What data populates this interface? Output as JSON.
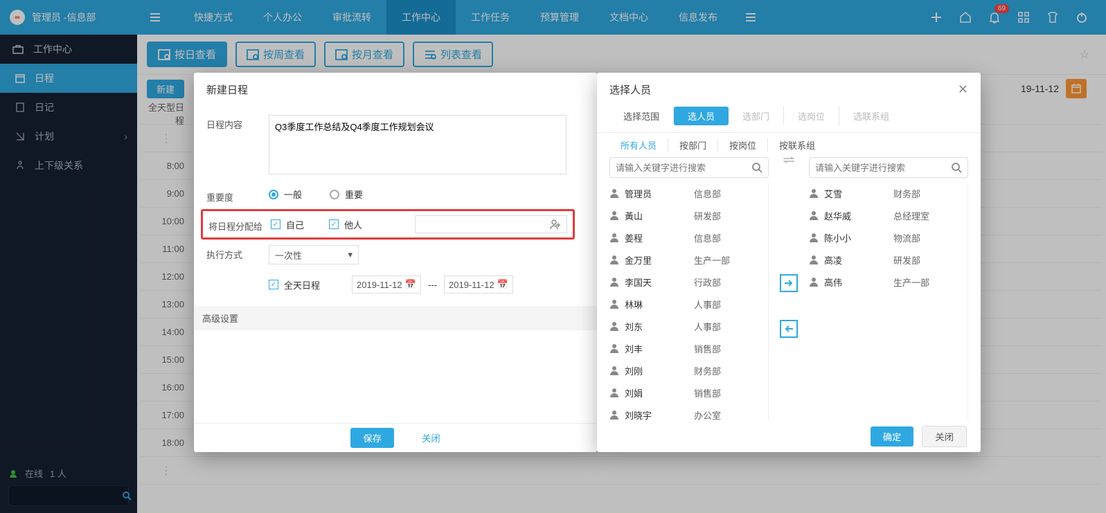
{
  "header": {
    "admin_label": "管理员 -信息部",
    "nav": {
      "quick": "快捷方式",
      "personal": "个人办公",
      "approval": "审批流转",
      "workcenter": "工作中心",
      "worktask": "工作任务",
      "budget": "预算管理",
      "doccenter": "文档中心",
      "info": "信息发布"
    },
    "badge": "69"
  },
  "sidebar": {
    "workcenter": "工作中心",
    "schedule": "日程",
    "diary": "日记",
    "plan": "计划",
    "relation": "上下级关系",
    "online": "在线",
    "online_count": "1 人"
  },
  "viewtabs": {
    "day": "按日查看",
    "week": "按周查看",
    "month": "按月查看",
    "list": "列表查看"
  },
  "toolbar": {
    "new": "新建",
    "date": "19-11-12"
  },
  "calendar": {
    "allday": "全天型日程",
    "hours": [
      "8:00",
      "9:00",
      "10:00",
      "11:00",
      "12:00",
      "13:00",
      "14:00",
      "15:00",
      "16:00",
      "17:00",
      "18:00"
    ]
  },
  "dialog1": {
    "title": "新建日程",
    "labels": {
      "content": "日程内容",
      "importance": "重要度",
      "assign": "将日程分配给",
      "mode": "执行方式",
      "advanced": "高级设置"
    },
    "content_value": "Q3季度工作总结及Q4季度工作规划会议",
    "importance": {
      "normal": "一般",
      "important": "重要"
    },
    "assign": {
      "self": "自己",
      "other": "他人"
    },
    "mode_value": "一次性",
    "allday": "全天日程",
    "date_from": "2019-11-12",
    "date_to": "2019-11-12",
    "date_sep": "---",
    "save": "保存",
    "close": "关闭"
  },
  "dialog2": {
    "title": "选择人员",
    "scope": {
      "range": "选择范围",
      "person": "选人员",
      "dept": "选部门",
      "post": "选岗位",
      "contact": "选联系组"
    },
    "filter": {
      "all": "所有人员",
      "bydept": "按部门",
      "bypost": "按岗位",
      "bycontact": "按联系组"
    },
    "search_ph": "请输入关键字进行搜索",
    "left": [
      {
        "name": "管理员",
        "dept": "信息部"
      },
      {
        "name": "黃山",
        "dept": "研发部"
      },
      {
        "name": "姜程",
        "dept": "信息部"
      },
      {
        "name": "金万里",
        "dept": "生产一部"
      },
      {
        "name": "李国天",
        "dept": "行政部"
      },
      {
        "name": "林琳",
        "dept": "人事部"
      },
      {
        "name": "刘东",
        "dept": "人事部"
      },
      {
        "name": "刘丰",
        "dept": "销售部"
      },
      {
        "name": "刘刚",
        "dept": "财务部"
      },
      {
        "name": "刘娟",
        "dept": "销售部"
      },
      {
        "name": "刘晓宇",
        "dept": "办公室"
      }
    ],
    "right": [
      {
        "name": "艾雪",
        "dept": "财务部"
      },
      {
        "name": "赵华威",
        "dept": "总经理室"
      },
      {
        "name": "陈小小",
        "dept": "物流部"
      },
      {
        "name": "高凌",
        "dept": "研发部"
      },
      {
        "name": "高伟",
        "dept": "生产一部"
      }
    ],
    "ok": "确定",
    "close": "关闭"
  }
}
